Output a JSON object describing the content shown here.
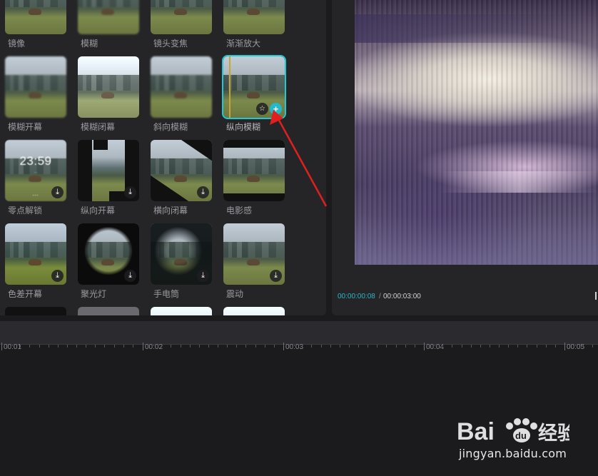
{
  "effects": [
    {
      "label": "镜像"
    },
    {
      "label": "模糊"
    },
    {
      "label": "镜头变焦"
    },
    {
      "label": "渐渐放大"
    },
    {
      "label": "模糊开幕"
    },
    {
      "label": "模糊闭幕"
    },
    {
      "label": "斜向模糊"
    },
    {
      "label": "纵向模糊",
      "selected": true
    },
    {
      "label": "零点解锁",
      "clock_time": "23:59",
      "clock_subtitle": "…",
      "dots": "…"
    },
    {
      "label": "纵向开幕"
    },
    {
      "label": "横向闭幕"
    },
    {
      "label": "电影感"
    },
    {
      "label": "色差开幕"
    },
    {
      "label": "聚光灯"
    },
    {
      "label": "手电筒"
    },
    {
      "label": "震动"
    }
  ],
  "preview": {
    "current_time": "00:00:00:08",
    "separator": "/",
    "total_time": "00:00:03:00"
  },
  "timeline": {
    "ticks": [
      "00:01",
      "00:02",
      "00:03",
      "00:04",
      "00:05"
    ]
  },
  "icons": {
    "download": "download-icon",
    "favorite": "star-icon",
    "add": "plus-icon"
  },
  "colors": {
    "accent": "#22c7d4",
    "time_current": "#2ab7c5",
    "annotation_arrow": "#e0201f"
  },
  "watermark": {
    "logo_text": "Bai 经验",
    "url": "jingyan.baidu.com"
  }
}
